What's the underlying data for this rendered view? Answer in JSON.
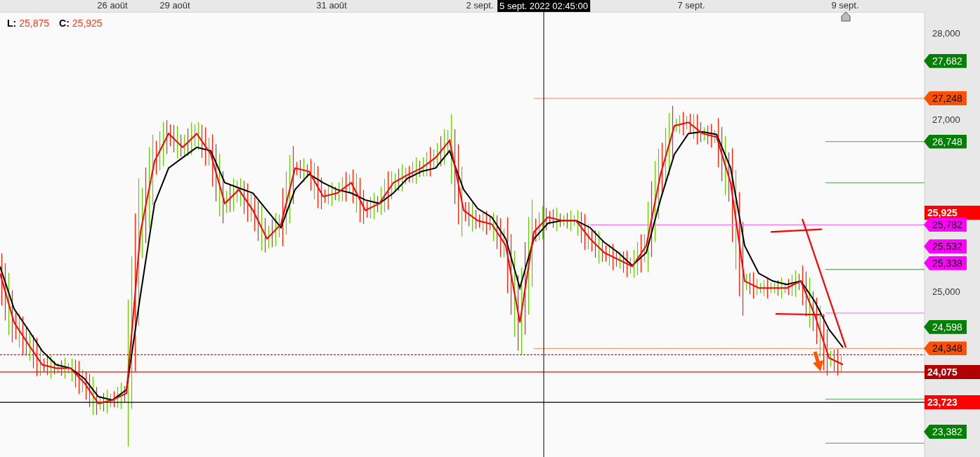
{
  "legend": [
    {
      "label": "L:",
      "value": "25,875"
    },
    {
      "label": "C:",
      "value": "25,925"
    }
  ],
  "date_labels": [
    "26 août",
    "29 août",
    "31 août",
    "2 sept.",
    "7 sept.",
    "9 sept."
  ],
  "crosshair_label": "5 sept. 2022 02:45:00",
  "price_axis_labels": [
    "28,000",
    "27,000",
    "25,000"
  ],
  "price_tags": [
    {
      "text": "27,682",
      "kind": "pointer",
      "color": "#008000"
    },
    {
      "text": "27,248",
      "kind": "pointer",
      "color": "#ff5000"
    },
    {
      "text": "26,748",
      "kind": "pointer",
      "color": "#008000"
    },
    {
      "text": "25,925",
      "kind": "flat",
      "color": "#ff0000"
    },
    {
      "text": "25,782",
      "kind": "pointer",
      "color": "#ff00ff"
    },
    {
      "text": "25,532",
      "kind": "pointer",
      "color": "#ff00ff"
    },
    {
      "text": "25,338",
      "kind": "pointer",
      "color": "#ff00ff"
    },
    {
      "text": "24,598",
      "kind": "pointer",
      "color": "#008000"
    },
    {
      "text": "24,348",
      "kind": "pointer",
      "color": "#ff5000"
    },
    {
      "text": "24,075",
      "kind": "flat",
      "color": "#b00000"
    },
    {
      "text": "23,723",
      "kind": "flat",
      "color": "#ff0000"
    },
    {
      "text": "23,382",
      "kind": "pointer",
      "color": "#008000"
    }
  ]
}
